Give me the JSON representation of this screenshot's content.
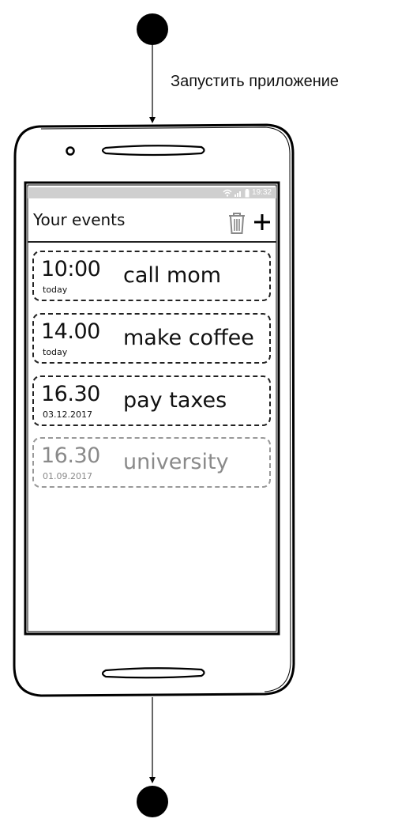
{
  "diagram": {
    "transition_label": "Запустить приложение"
  },
  "app": {
    "status_time": "19:32",
    "title": "Your events",
    "icons": {
      "delete": "trash-icon",
      "add": "plus-icon",
      "wifi": "wifi-icon",
      "signal": "signal-icon",
      "battery": "battery-icon"
    },
    "events": [
      {
        "time": "10:00",
        "date": "today",
        "title": "call mom",
        "muted": false
      },
      {
        "time": "14.00",
        "date": "today",
        "title": "make coffee",
        "muted": false
      },
      {
        "time": "16.30",
        "date": "03.12.2017",
        "title": "pay taxes",
        "muted": false
      },
      {
        "time": "16.30",
        "date": "01.09.2017",
        "title": "university",
        "muted": true
      }
    ]
  }
}
